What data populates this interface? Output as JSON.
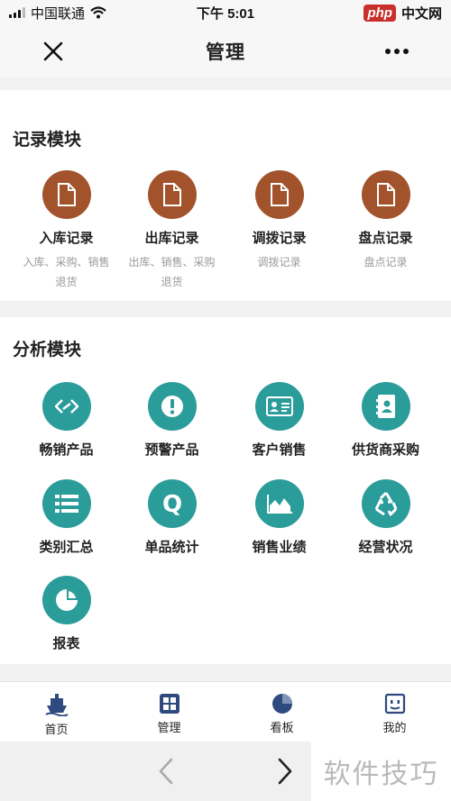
{
  "status_bar": {
    "carrier": "中国联通",
    "time": "下午 5:01",
    "brand_badge": "php",
    "brand_text": "中文网"
  },
  "title_bar": {
    "title": "管理",
    "close_icon": "close-icon",
    "more_icon": "more-icon"
  },
  "record_section": {
    "title": "记录模块",
    "items": [
      {
        "label": "入库记录",
        "desc_line1": "入库、采购、销售",
        "desc_line2": "退货",
        "icon": "document-icon"
      },
      {
        "label": "出库记录",
        "desc_line1": "出库、销售、采购",
        "desc_line2": "退货",
        "icon": "document-icon"
      },
      {
        "label": "调拨记录",
        "desc_line1": "调拨记录",
        "desc_line2": "",
        "icon": "document-icon"
      },
      {
        "label": "盘点记录",
        "desc_line1": "盘点记录",
        "desc_line2": "",
        "icon": "document-icon"
      }
    ]
  },
  "analysis_section": {
    "title": "分析模块",
    "items": [
      {
        "label": "畅销产品",
        "icon": "link-chain-icon"
      },
      {
        "label": "预警产品",
        "icon": "alert-icon"
      },
      {
        "label": "客户销售",
        "icon": "id-card-icon"
      },
      {
        "label": "供货商采购",
        "icon": "address-book-icon"
      },
      {
        "label": "类别汇总",
        "icon": "list-icon"
      },
      {
        "label": "单品统计",
        "icon": "letter-q-icon"
      },
      {
        "label": "销售业绩",
        "icon": "area-chart-icon"
      },
      {
        "label": "经营状况",
        "icon": "recycle-icon"
      },
      {
        "label": "报表",
        "icon": "pie-chart-icon"
      }
    ]
  },
  "bottom_nav": {
    "items": [
      {
        "label": "首页",
        "icon": "ship-icon"
      },
      {
        "label": "管理",
        "icon": "grid-icon"
      },
      {
        "label": "看板",
        "icon": "pie-icon"
      },
      {
        "label": "我的",
        "icon": "face-icon"
      }
    ]
  },
  "watermark": "软件技巧",
  "colors": {
    "brown": "#a2532b",
    "teal": "#2a9c9a",
    "nav_blue": "#2f4a7e"
  }
}
